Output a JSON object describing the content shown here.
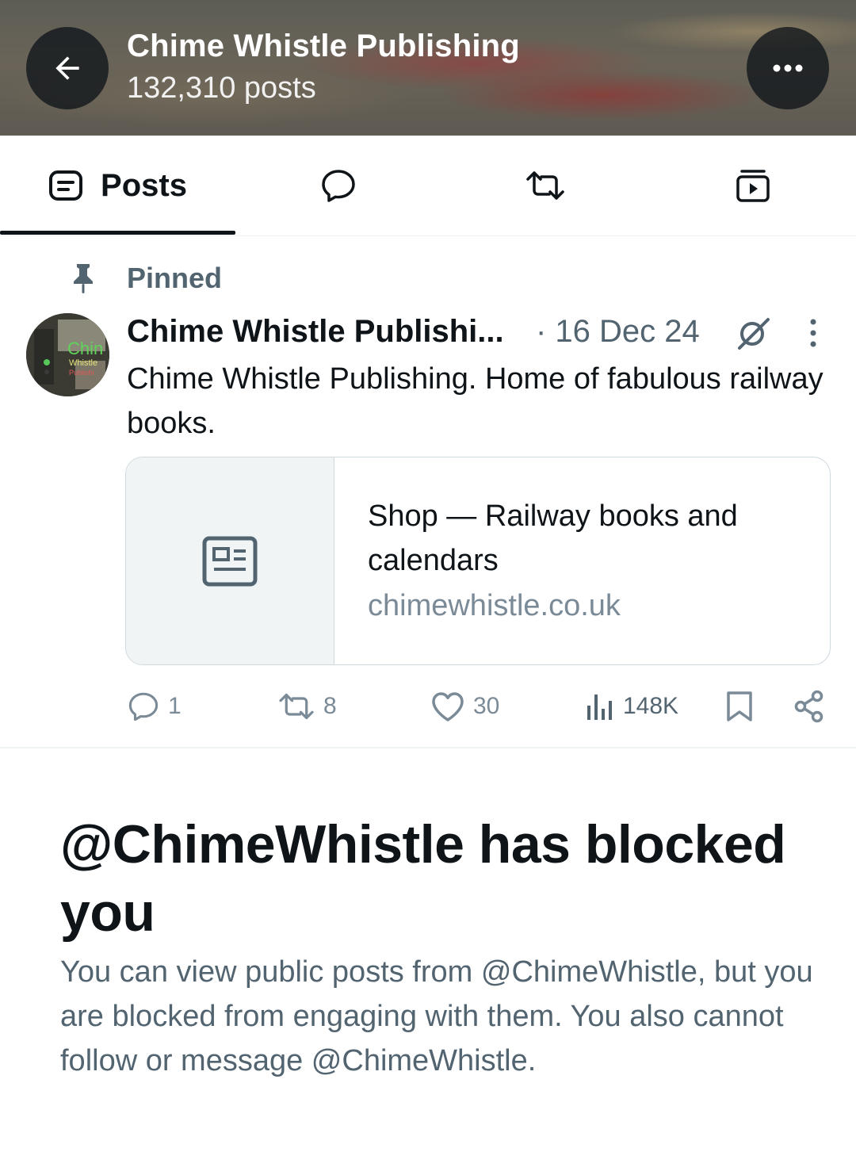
{
  "header": {
    "title": "Chime Whistle Publishing",
    "post_count": "132,310 posts",
    "back_icon": "arrow-left-icon",
    "more_icon": "more-horizontal-icon"
  },
  "tabs": {
    "active": "Posts",
    "items": [
      {
        "label": "Posts",
        "icon": "posts-icon"
      },
      {
        "label": "",
        "icon": "reply-bubble-icon"
      },
      {
        "label": "",
        "icon": "repost-icon"
      },
      {
        "label": "",
        "icon": "media-play-icon"
      }
    ]
  },
  "pinned_post": {
    "pinned_label": "Pinned",
    "author_name": "Chime Whistle Publishi...",
    "date": "· 16 Dec 24",
    "text": "Chime Whistle Publishing. Home of fabulous railway books.",
    "avatar_text": {
      "line1": "Chin",
      "line2": "Whistle",
      "line3": "Publishi"
    },
    "link_card": {
      "title": "Shop — Railway books and calendars",
      "domain": "chimewhistle.co.uk",
      "thumbnail_icon": "article-icon"
    },
    "actions": {
      "replies": "1",
      "reposts": "8",
      "likes": "30",
      "views": "148K"
    }
  },
  "blocked_notice": {
    "title": "@ChimeWhistle has blocked you",
    "description": "You can view public posts from @ChimeWhistle, but you are blocked from engaging with them. You also cannot follow or message @ChimeWhistle."
  },
  "colors": {
    "text_primary": "#0f1419",
    "text_secondary": "#536471",
    "border": "#cfd9de",
    "card_thumb_bg": "#f1f4f5"
  }
}
